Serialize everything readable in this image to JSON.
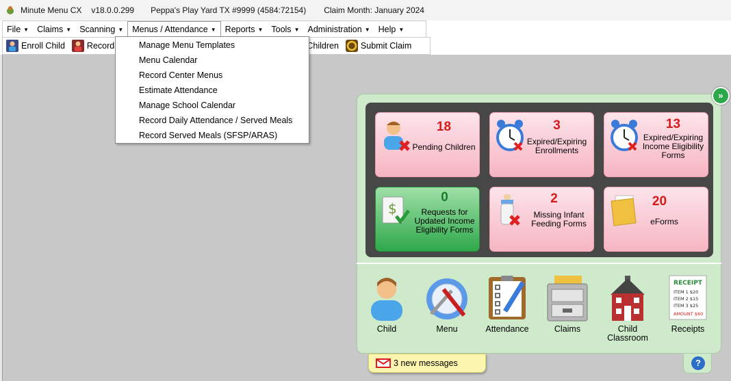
{
  "titlebar": {
    "app_name": "Minute Menu CX",
    "version": "v18.0.0.299",
    "center": "Peppa's Play Yard TX #9999 (4584:72154)",
    "claim_month": "Claim Month: January 2024"
  },
  "menubar": [
    "File",
    "Claims",
    "Scanning",
    "Menus / Attendance",
    "Reports",
    "Tools",
    "Administration",
    "Help"
  ],
  "toolbar": {
    "enroll": "Enroll Child",
    "record": "Record A",
    "children": "Children",
    "submit": "Submit Claim"
  },
  "dropdown": [
    "Manage Menu Templates",
    "Menu Calendar",
    "Record Center Menus",
    "Estimate Attendance",
    "Manage School Calendar",
    "Record Daily Attendance / Served Meals",
    "Record Served Meals (SFSP/ARAS)"
  ],
  "tiles": [
    {
      "count": "18",
      "label": "Pending Children",
      "icon": "child-with-x-icon"
    },
    {
      "count": "3",
      "label": "Expired/Expiring Enrollments",
      "icon": "alarm-clock-icon"
    },
    {
      "count": "13",
      "label": "Expired/Expiring Income Eligibility Forms",
      "icon": "alarm-clock-icon"
    },
    {
      "count": "0",
      "label": "Requests for Updated Income Eligibility Forms",
      "icon": "money-document-check-icon"
    },
    {
      "count": "2",
      "label": "Missing Infant Feeding Forms",
      "icon": "baby-bottle-icon"
    },
    {
      "count": "20",
      "label": "eForms",
      "icon": "folder-icon"
    }
  ],
  "bottom": [
    "Child",
    "Menu",
    "Attendance",
    "Claims",
    "Child Classroom",
    "Receipts"
  ],
  "receipt": {
    "title": "RECEIPT",
    "lines": [
      "ITEM 1 $20",
      "ITEM 2 $15",
      "ITEM 3 $25"
    ],
    "amount": "AMOUNT $60"
  },
  "messages": "3 new messages",
  "help": "?",
  "colors": {
    "accent_red": "#d51a1a",
    "accent_green": "#1a7a2a",
    "panel_bg": "#cfeacb",
    "tiles_bg": "#474747"
  }
}
